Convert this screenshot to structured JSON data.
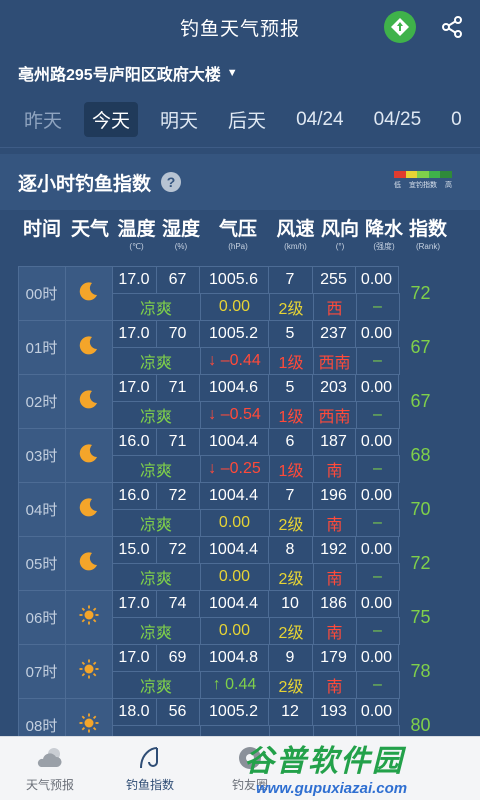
{
  "header": {
    "title": "钓鱼天气预报"
  },
  "location": {
    "name": "亳州路295号庐阳区政府大楼"
  },
  "day_tabs": [
    {
      "label": "昨天",
      "state": "muted"
    },
    {
      "label": "今天",
      "state": "active"
    },
    {
      "label": "明天",
      "state": "normal"
    },
    {
      "label": "后天",
      "state": "normal"
    },
    {
      "label": "04/24",
      "state": "normal"
    },
    {
      "label": "04/25",
      "state": "normal"
    },
    {
      "label": "0",
      "state": "normal"
    }
  ],
  "section": {
    "title": "逐小时钓鱼指数",
    "legend": {
      "low": "低",
      "mid": "宜钓指数",
      "high": "高",
      "colors": [
        "#e03c2f",
        "#e6d335",
        "#7fd04a",
        "#3fb24a",
        "#2f8a3a"
      ]
    }
  },
  "columns": [
    {
      "label": "时间",
      "unit": ""
    },
    {
      "label": "天气",
      "unit": ""
    },
    {
      "label": "温度",
      "unit": "(℃)"
    },
    {
      "label": "湿度",
      "unit": "(%)"
    },
    {
      "label": "气压",
      "unit": "(hPa)"
    },
    {
      "label": "风速",
      "unit": "(km/h)"
    },
    {
      "label": "风向",
      "unit": "(°)"
    },
    {
      "label": "降水",
      "unit": "(强度)"
    },
    {
      "label": "指数",
      "unit": "(Rank)"
    }
  ],
  "rows": [
    {
      "time": "00时",
      "icon": "moon-icon",
      "temp": "17.0",
      "hum": "67",
      "press": "1005.6",
      "wind": "7",
      "dir": "255",
      "rain": "0.00",
      "feel": "凉爽",
      "press_delta": "0.00",
      "press_trend": "zero",
      "level": "2级",
      "level_color": "yellow",
      "dir_name": "西",
      "rain_text": "–",
      "rank": "72"
    },
    {
      "time": "01时",
      "icon": "moon-icon",
      "temp": "17.0",
      "hum": "70",
      "press": "1005.2",
      "wind": "5",
      "dir": "237",
      "rain": "0.00",
      "feel": "凉爽",
      "press_delta": "↓ –0.44",
      "press_trend": "down",
      "level": "1级",
      "level_color": "red",
      "dir_name": "西南",
      "rain_text": "–",
      "rank": "67"
    },
    {
      "time": "02时",
      "icon": "moon-icon",
      "temp": "17.0",
      "hum": "71",
      "press": "1004.6",
      "wind": "5",
      "dir": "203",
      "rain": "0.00",
      "feel": "凉爽",
      "press_delta": "↓ –0.54",
      "press_trend": "down",
      "level": "1级",
      "level_color": "red",
      "dir_name": "西南",
      "rain_text": "–",
      "rank": "67"
    },
    {
      "time": "03时",
      "icon": "moon-icon",
      "temp": "16.0",
      "hum": "71",
      "press": "1004.4",
      "wind": "6",
      "dir": "187",
      "rain": "0.00",
      "feel": "凉爽",
      "press_delta": "↓ –0.25",
      "press_trend": "down",
      "level": "1级",
      "level_color": "red",
      "dir_name": "南",
      "rain_text": "–",
      "rank": "68"
    },
    {
      "time": "04时",
      "icon": "moon-icon",
      "temp": "16.0",
      "hum": "72",
      "press": "1004.4",
      "wind": "7",
      "dir": "196",
      "rain": "0.00",
      "feel": "凉爽",
      "press_delta": "0.00",
      "press_trend": "zero",
      "level": "2级",
      "level_color": "yellow",
      "dir_name": "南",
      "rain_text": "–",
      "rank": "70"
    },
    {
      "time": "05时",
      "icon": "moon-icon",
      "temp": "15.0",
      "hum": "72",
      "press": "1004.4",
      "wind": "8",
      "dir": "192",
      "rain": "0.00",
      "feel": "凉爽",
      "press_delta": "0.00",
      "press_trend": "zero",
      "level": "2级",
      "level_color": "yellow",
      "dir_name": "南",
      "rain_text": "–",
      "rank": "72"
    },
    {
      "time": "06时",
      "icon": "sun-icon",
      "temp": "17.0",
      "hum": "74",
      "press": "1004.4",
      "wind": "10",
      "dir": "186",
      "rain": "0.00",
      "feel": "凉爽",
      "press_delta": "0.00",
      "press_trend": "zero",
      "level": "2级",
      "level_color": "yellow",
      "dir_name": "南",
      "rain_text": "–",
      "rank": "75"
    },
    {
      "time": "07时",
      "icon": "sun-icon",
      "temp": "17.0",
      "hum": "69",
      "press": "1004.8",
      "wind": "9",
      "dir": "179",
      "rain": "0.00",
      "feel": "凉爽",
      "press_delta": "↑ 0.44",
      "press_trend": "up",
      "level": "2级",
      "level_color": "yellow",
      "dir_name": "南",
      "rain_text": "–",
      "rank": "78"
    },
    {
      "time": "08时",
      "icon": "sun-icon",
      "temp": "18.0",
      "hum": "56",
      "press": "1005.2",
      "wind": "12",
      "dir": "193",
      "rain": "0.00",
      "feel": "",
      "press_delta": "",
      "press_trend": "up",
      "level": "",
      "level_color": "yellow",
      "dir_name": "",
      "rain_text": "",
      "rank": "80"
    }
  ],
  "tabbar": [
    {
      "label": "天气预报",
      "icon": "cloud-sun-icon",
      "active": false
    },
    {
      "label": "钓鱼指数",
      "icon": "fishing-hook-icon",
      "active": true
    },
    {
      "label": "钓友圈",
      "icon": "aperture-icon",
      "active": false
    }
  ],
  "watermark": {
    "main": "谷普软件园",
    "url": "www.gupuxiazai.com"
  }
}
